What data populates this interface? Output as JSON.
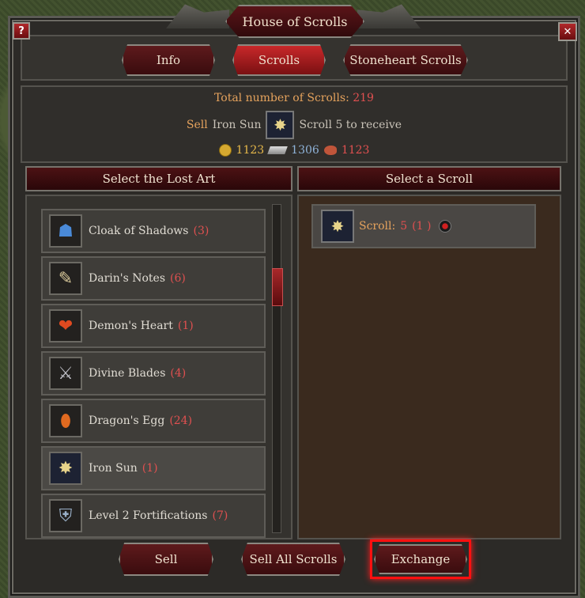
{
  "window": {
    "title": "House of Scrolls",
    "help_label": "?",
    "close_label": "✕"
  },
  "tabs": [
    {
      "label": "Info"
    },
    {
      "label": "Scrolls"
    },
    {
      "label": "Stoneheart Scrolls"
    }
  ],
  "info": {
    "total_label": "Total number of Scrolls:",
    "total_value": "219",
    "sell_prefix": "Sell",
    "sell_item": "Iron Sun",
    "sell_scroll": "Scroll 5 to receive",
    "gold": "1123",
    "iron": "1306",
    "meat": "1123"
  },
  "left": {
    "header": "Select the Lost Art",
    "items": [
      {
        "name": "Cloak of Shadows",
        "count": "(3)",
        "icon": "hood-icon"
      },
      {
        "name": "Darin's Notes",
        "count": "(6)",
        "icon": "notes-icon"
      },
      {
        "name": "Demon's Heart",
        "count": "(1)",
        "icon": "heart-icon"
      },
      {
        "name": "Divine Blades",
        "count": "(4)",
        "icon": "blades-icon"
      },
      {
        "name": "Dragon's Egg",
        "count": "(24)",
        "icon": "egg-icon"
      },
      {
        "name": "Iron Sun",
        "count": "(1)",
        "icon": "sun-icon"
      },
      {
        "name": "Level 2 Fortifications",
        "count": "(7)",
        "icon": "shield-icon"
      }
    ]
  },
  "right": {
    "header": "Select a Scroll",
    "scroll_label": "Scroll:",
    "scroll_number": "5",
    "scroll_count": "(1 )"
  },
  "buttons": {
    "sell": "Sell",
    "sell_all": "Sell All Scrolls",
    "exchange": "Exchange"
  },
  "colors": {
    "accent_red": "#c8282a",
    "gold_text": "#e6a35d",
    "count_red": "#e05050",
    "iron_blue": "#8fb3d9"
  }
}
